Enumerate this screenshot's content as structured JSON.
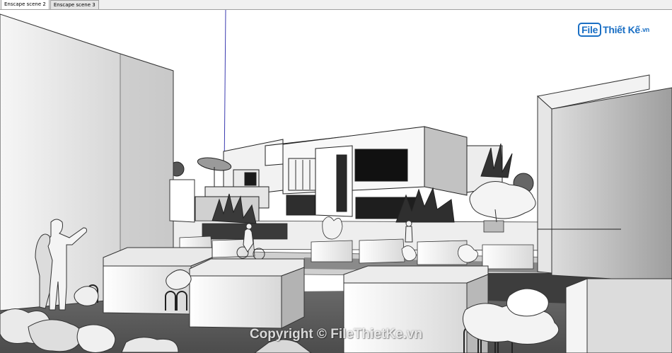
{
  "tabs": [
    {
      "label": "Enscape scene 2",
      "active": true
    },
    {
      "label": "Enscape scene 3",
      "active": false
    }
  ],
  "logo": {
    "file": "File",
    "name": "Thiết Kế",
    "tld": ".vn",
    "color": "#1a6fc4"
  },
  "watermark": {
    "text": "Copyright © FileThietKe.vn"
  },
  "viewport": {
    "style": "monochrome sketch",
    "background": "#ffffff",
    "axis_color": "#3b3bb0"
  }
}
